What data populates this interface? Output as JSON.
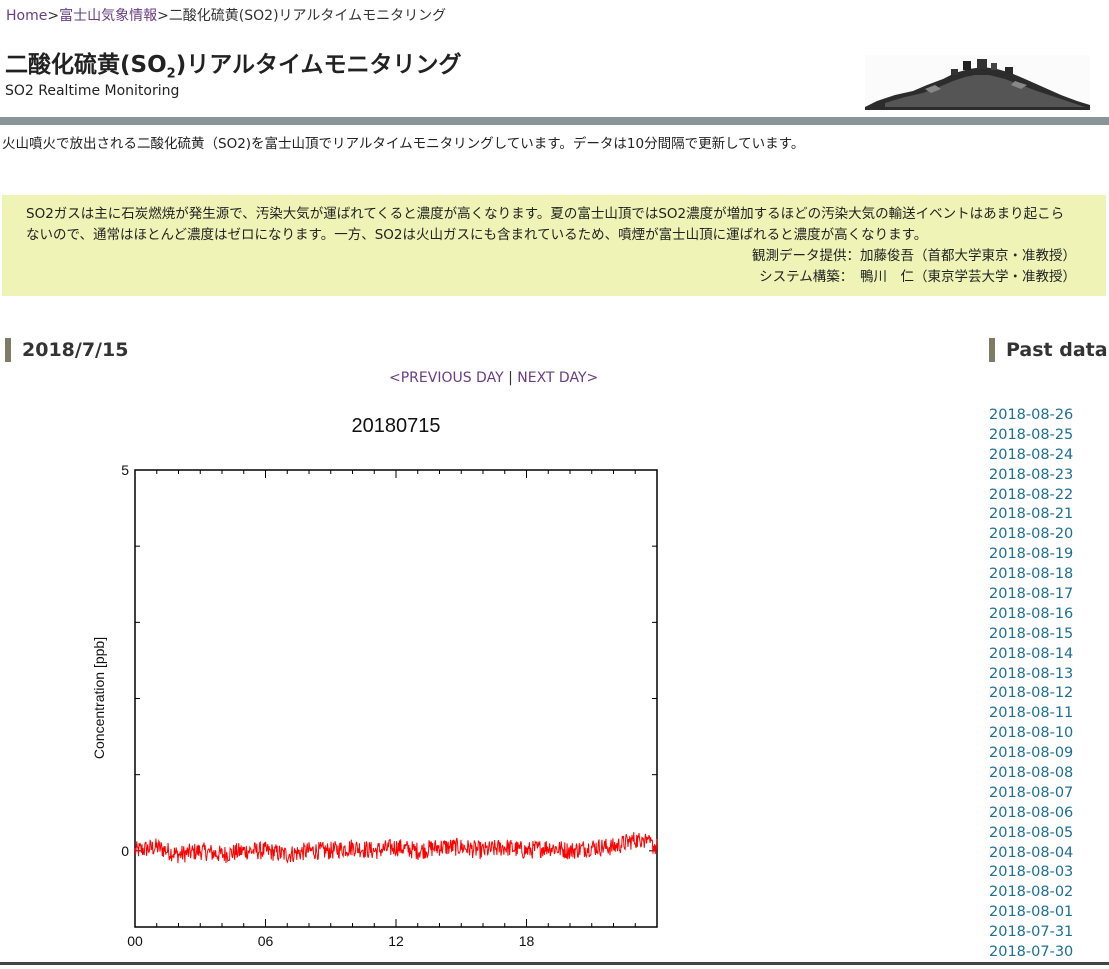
{
  "breadcrumb": {
    "home": "Home",
    "sep1": ">",
    "parent": "富士山気象情報",
    "sep2": ">",
    "current": "二酸化硫黄(SO2)リアルタイムモニタリング"
  },
  "header": {
    "title_main": "二酸化硫黄(SO",
    "title_sub": "2",
    "title_end": ")リアルタイムモニタリング",
    "subtitle": "SO2 Realtime Monitoring"
  },
  "intro": "火山噴火で放出される二酸化硫黄（SO2)を富士山頂でリアルタイムモニタリングしています。データは10分間隔で更新しています。",
  "notice": {
    "body": "SO2ガスは主に石炭燃焼が発生源で、汚染大気が運ばれてくると濃度が高くなります。夏の富士山頂ではSO2濃度が増加するほどの汚染大気の輸送イベントはあまり起こらないので、通常はほとんど濃度はゼロになります。一方、SO2は火山ガスにも含まれているため、噴煙が富士山頂に運ばれると濃度が高くなります。",
    "credit1": "観測データ提供：加藤俊吾（首都大学東京・准教授）",
    "credit2": "システム構築：　鴨川　仁（東京学芸大学・准教授）"
  },
  "date_heading": "2018/7/15",
  "day_nav": {
    "prev": "<PREVIOUS DAY",
    "sep": "|",
    "next": "NEXT DAY>"
  },
  "past": {
    "heading": "Past data",
    "dates": [
      "2018-08-26",
      "2018-08-25",
      "2018-08-24",
      "2018-08-23",
      "2018-08-22",
      "2018-08-21",
      "2018-08-20",
      "2018-08-19",
      "2018-08-18",
      "2018-08-17",
      "2018-08-16",
      "2018-08-15",
      "2018-08-14",
      "2018-08-13",
      "2018-08-12",
      "2018-08-11",
      "2018-08-10",
      "2018-08-09",
      "2018-08-08",
      "2018-08-07",
      "2018-08-06",
      "2018-08-05",
      "2018-08-04",
      "2018-08-03",
      "2018-08-02",
      "2018-08-01",
      "2018-07-31",
      "2018-07-30"
    ]
  },
  "chart_data": {
    "type": "line",
    "title": "20180715",
    "ylabel": "Concentration [ppb]",
    "xlabel": "",
    "x_ticks": [
      "00",
      "06",
      "12",
      "18"
    ],
    "y_ticks": [
      "5",
      "0"
    ],
    "xlim": [
      0,
      24
    ],
    "ylim": [
      -1,
      5
    ],
    "series": [
      {
        "color": "#ff0000",
        "x": [
          0,
          1,
          2,
          3,
          4,
          5,
          6,
          7,
          8,
          9,
          10,
          11,
          12,
          13,
          14,
          15,
          16,
          17,
          18,
          19,
          20,
          21,
          22,
          23,
          24
        ],
        "y": [
          0.0,
          0.05,
          -0.05,
          0.0,
          -0.05,
          0.0,
          0.0,
          -0.05,
          0.0,
          0.0,
          0.05,
          0.0,
          0.05,
          0.0,
          0.05,
          0.05,
          0.0,
          0.05,
          0.0,
          0.05,
          0.0,
          0.05,
          0.05,
          0.15,
          0.05
        ]
      }
    ],
    "noise_amplitude": 0.12,
    "grid": false
  }
}
